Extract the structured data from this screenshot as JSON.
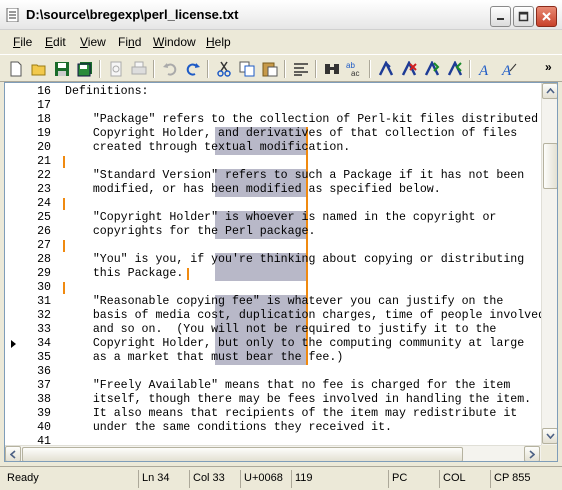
{
  "window": {
    "title": "D:\\source\\bregexp\\perl_license.txt",
    "minimize_glyph": "–",
    "maximize_glyph": "□",
    "close_glyph": "✕"
  },
  "menu": [
    "File",
    "Edit",
    "View",
    "Find",
    "Window",
    "Help"
  ],
  "toolbar": {
    "buttons": [
      "new-document-icon",
      "open-folder-icon",
      "save-icon",
      "save-all-icon",
      "print-preview-icon",
      "print-icon",
      "undo-icon",
      "redo-icon",
      "cut-icon",
      "copy-icon",
      "paste-icon",
      "line-format-icon",
      "find-icon",
      "replace-icon",
      "bookmark-set-icon",
      "bookmark-clear-icon",
      "bookmark-next-icon",
      "bookmark-prev-icon",
      "font-icon",
      "font-italic-icon"
    ],
    "overflow_glyph": "»"
  },
  "editor": {
    "lines": [
      {
        "n": "16",
        "t": "Definitions:"
      },
      {
        "n": "17",
        "t": ""
      },
      {
        "n": "18",
        "t": "    \"Package\" refers to the collection of Perl-kit files distributed by the"
      },
      {
        "n": "19",
        "t": "    Copyright Holder, and derivatives of that collection of files"
      },
      {
        "n": "20",
        "t": "    created through textual modification."
      },
      {
        "n": "21",
        "t": ""
      },
      {
        "n": "22",
        "t": "    \"Standard Version\" refers to such a Package if it has not been"
      },
      {
        "n": "23",
        "t": "    modified, or has been modified as specified below."
      },
      {
        "n": "24",
        "t": ""
      },
      {
        "n": "25",
        "t": "    \"Copyright Holder\" is whoever is named in the copyright or"
      },
      {
        "n": "26",
        "t": "    copyrights for the Perl package."
      },
      {
        "n": "27",
        "t": ""
      },
      {
        "n": "28",
        "t": "    \"You\" is you, if you're thinking about copying or distributing"
      },
      {
        "n": "29",
        "t": "    this Package."
      },
      {
        "n": "30",
        "t": ""
      },
      {
        "n": "31",
        "t": "    \"Reasonable copying fee\" is whatever you can justify on the"
      },
      {
        "n": "32",
        "t": "    basis of media cost, duplication charges, time of people involved,"
      },
      {
        "n": "33",
        "t": "    and so on.  (You will not be required to justify it to the"
      },
      {
        "n": "34",
        "t": "    Copyright Holder, but only to the computing community at large"
      },
      {
        "n": "35",
        "t": "    as a market that must bear the fee.)"
      },
      {
        "n": "36",
        "t": ""
      },
      {
        "n": "37",
        "t": "    \"Freely Available\" means that no fee is charged for the item"
      },
      {
        "n": "38",
        "t": "    itself, though there may be fees involved in handling the item."
      },
      {
        "n": "39",
        "t": "    It also means that recipients of the item may redistribute it"
      },
      {
        "n": "40",
        "t": "    under the same conditions they received it."
      },
      {
        "n": "41",
        "t": ""
      }
    ]
  },
  "status": {
    "ready": "Ready",
    "line": "Ln 34",
    "col": "Col 33",
    "codepoint": "U+0068",
    "char_code": "119",
    "newline": "PC",
    "mode": "COL",
    "codepage": "CP 855"
  }
}
